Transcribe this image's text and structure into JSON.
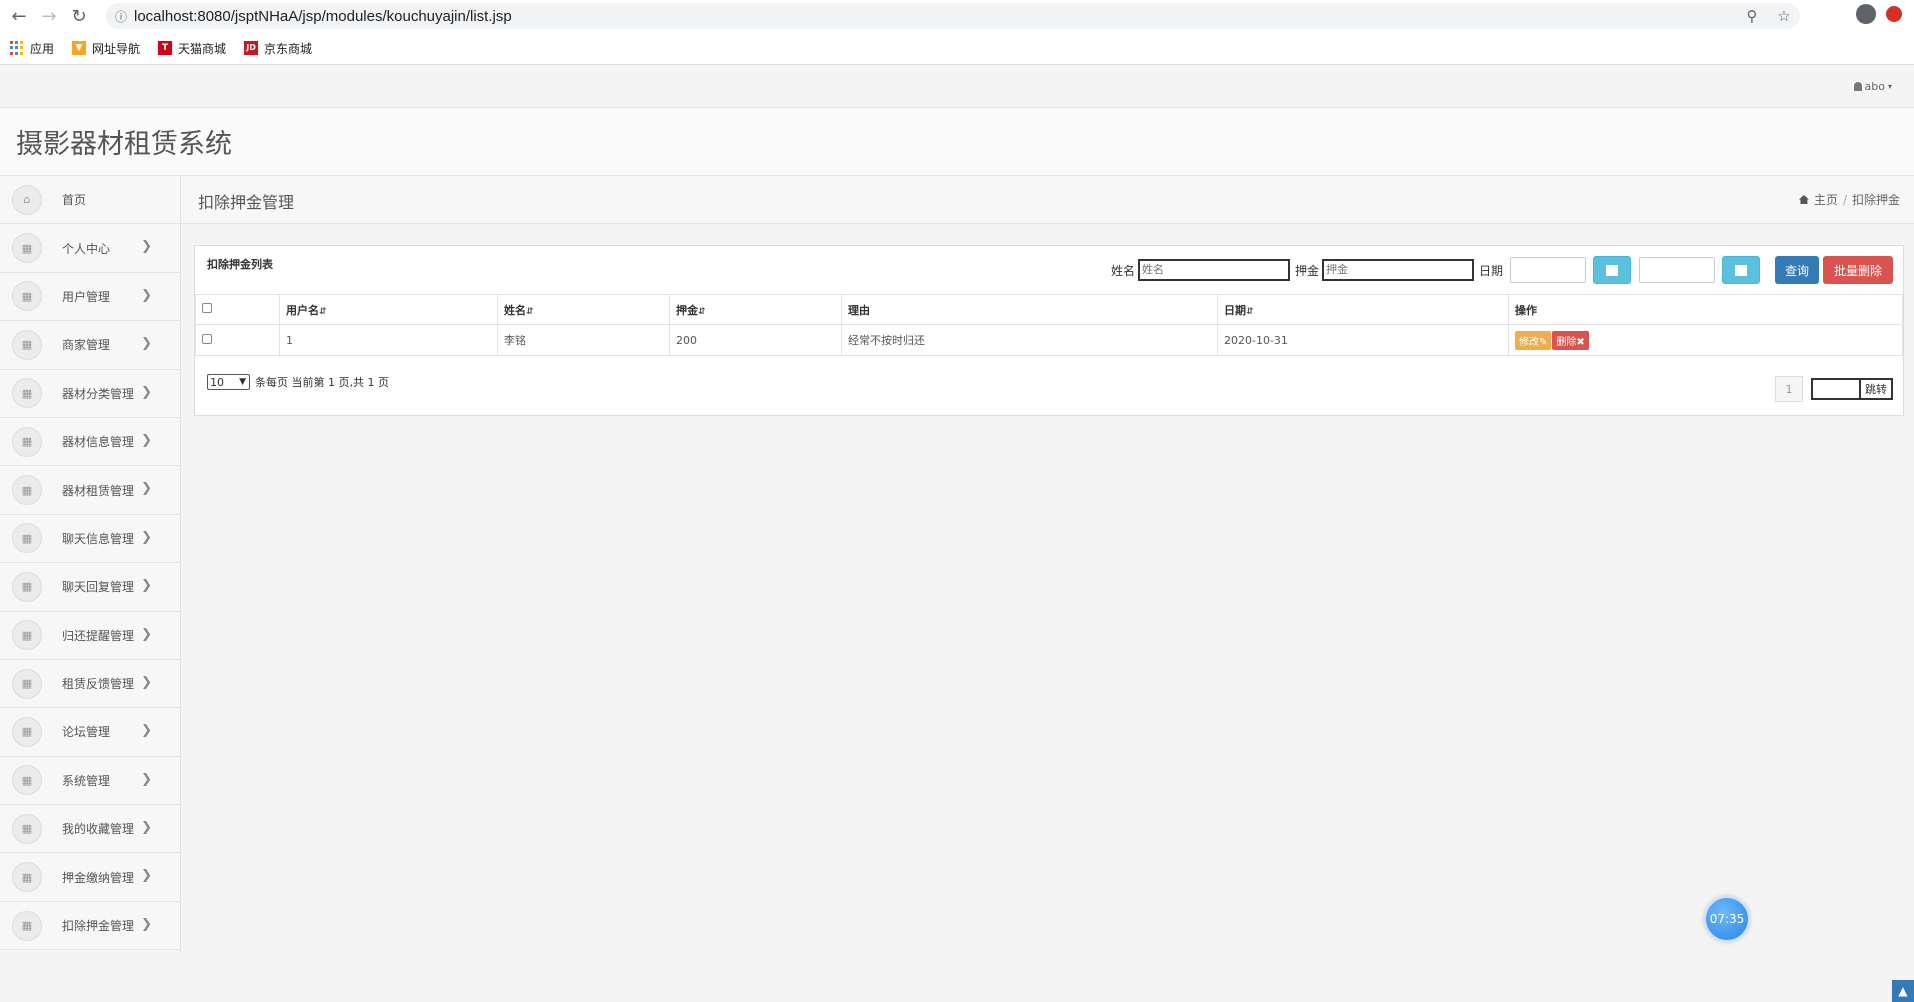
{
  "browser": {
    "url": "localhost:8080/jsptNHaA/jsp/modules/kouchuyajin/list.jsp",
    "bookmarks": [
      {
        "label": "应用",
        "icon": "apps-grid-icon"
      },
      {
        "label": "网址导航",
        "icon": "nav-bookmark-icon"
      },
      {
        "label": "天猫商城",
        "icon": "tmall-icon"
      },
      {
        "label": "京东商城",
        "icon": "jd-icon"
      }
    ]
  },
  "header": {
    "user": "abo",
    "system_title": "摄影器材租赁系统"
  },
  "sidebar": {
    "items": [
      {
        "label": "首页",
        "icon": "home-icon",
        "has_chevron": false
      },
      {
        "label": "个人中心",
        "icon": "table-icon",
        "has_chevron": true
      },
      {
        "label": "用户管理",
        "icon": "table-icon",
        "has_chevron": true
      },
      {
        "label": "商家管理",
        "icon": "table-icon",
        "has_chevron": true
      },
      {
        "label": "器材分类管理",
        "icon": "table-icon",
        "has_chevron": true
      },
      {
        "label": "器材信息管理",
        "icon": "table-icon",
        "has_chevron": true
      },
      {
        "label": "器材租赁管理",
        "icon": "table-icon",
        "has_chevron": true
      },
      {
        "label": "聊天信息管理",
        "icon": "table-icon",
        "has_chevron": true
      },
      {
        "label": "聊天回复管理",
        "icon": "table-icon",
        "has_chevron": true
      },
      {
        "label": "归还提醒管理",
        "icon": "table-icon",
        "has_chevron": true
      },
      {
        "label": "租赁反馈管理",
        "icon": "table-icon",
        "has_chevron": true
      },
      {
        "label": "论坛管理",
        "icon": "table-icon",
        "has_chevron": true
      },
      {
        "label": "系统管理",
        "icon": "table-icon",
        "has_chevron": true
      },
      {
        "label": "我的收藏管理",
        "icon": "table-icon",
        "has_chevron": true
      },
      {
        "label": "押金缴纳管理",
        "icon": "table-icon",
        "has_chevron": true
      },
      {
        "label": "扣除押金管理",
        "icon": "table-icon",
        "has_chevron": true
      }
    ]
  },
  "content": {
    "title": "扣除押金管理",
    "breadcrumb": {
      "home": "主页",
      "separator": "/",
      "current": "扣除押金"
    }
  },
  "panel": {
    "title": "扣除押金列表",
    "search": {
      "name_label": "姓名",
      "name_placeholder": "姓名",
      "deposit_label": "押金",
      "deposit_placeholder": "押金",
      "date_label": "日期",
      "query_label": "查询",
      "batch_delete_label": "批量删除"
    },
    "table": {
      "columns": [
        "用户名",
        "姓名",
        "押金",
        "理由",
        "日期",
        "操作"
      ],
      "sortable": [
        true,
        true,
        true,
        false,
        true,
        false
      ],
      "rows": [
        {
          "username": "1",
          "name": "李铭",
          "deposit": "200",
          "reason": "经常不按时归还",
          "date": "2020-10-31"
        }
      ],
      "edit_label": "修改",
      "delete_label": "删除"
    },
    "pager": {
      "per_page": "10",
      "summary": "条每页 当前第 1 页,共 1 页",
      "current_page": "1",
      "jump_label": "跳转"
    }
  },
  "clock": "07:35",
  "colors": {
    "primary": "#337ab7",
    "danger": "#d9534f",
    "info": "#5bc0de",
    "warning": "#f0ad4e"
  }
}
